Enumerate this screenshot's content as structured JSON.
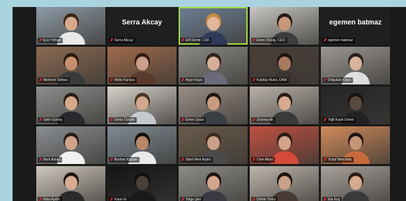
{
  "meeting": {
    "participants": [
      {
        "name": "Ece Yılmaz",
        "camera": true,
        "skin": "#d8a988",
        "hair": "#3a2616",
        "shirt": "#e9e9ea",
        "bg": "#8c9aa6"
      },
      {
        "name": "Serra Akcay",
        "camera": false,
        "display_name": "Serra Akcay"
      },
      {
        "name": "Elif Demir, CSK",
        "camera": true,
        "active": true,
        "skin": "#e3b59a",
        "hair": "#c78a3e",
        "shirt": "#2f3a58",
        "bg": "#6d7f96"
      },
      {
        "name": "Emre Okyay, CEO",
        "camera": true,
        "skin": "#c9977a",
        "hair": "#241a14",
        "shirt": "#3c3c3c",
        "bg": "#c8c6c2"
      },
      {
        "name": "egemen batmaz",
        "camera": false,
        "display_name": "egemen batmaz"
      },
      {
        "name": "Mehmet Tahtacı",
        "camera": true,
        "skin": "#c68e6c",
        "hair": "#2a1c12",
        "shirt": "#3b3a3a",
        "bg": "#8b6a52"
      },
      {
        "name": "Melis Karaca",
        "camera": true,
        "skin": "#caa08a",
        "hair": "#2d1b12",
        "shirt": "#5a3a2c",
        "bg": "#a06a4a"
      },
      {
        "name": "Ayşe Kaya",
        "camera": true,
        "skin": "#d8ae98",
        "hair": "#2e2019",
        "shirt": "#6a6a78",
        "bg": "#8b8a85"
      },
      {
        "name": "Kubilay Bulut, DAM",
        "camera": true,
        "skin": "#a87a60",
        "hair": "#1f1712",
        "shirt": "#3a3330",
        "bg": "#4a3f36"
      },
      {
        "name": "Doğukan Kaya",
        "camera": true,
        "skin": "#d9b29c",
        "hair": "#2a1e18",
        "shirt": "#dedede",
        "bg": "#9a9794"
      },
      {
        "name": "Selin Güneş",
        "camera": true,
        "skin": "#d6a888",
        "hair": "#2b1e15",
        "shirt": "#2a2a2e",
        "bg": "#8c8f8c"
      },
      {
        "name": "Deniz Öztürk",
        "camera": true,
        "skin": "#d2a88d",
        "hair": "#4a3422",
        "shirt": "#c5c9cf",
        "bg": "#d6d2cb"
      },
      {
        "name": "Emre Uysal",
        "camera": true,
        "skin": "#c99a7c",
        "hair": "#1e1712",
        "shirt": "#3a3f44",
        "bg": "#9a8f86"
      },
      {
        "name": "Zeynep Ak",
        "camera": true,
        "skin": "#d8aa92",
        "hair": "#2b1c15",
        "shirt": "#3a3a3a",
        "bg": "#b8b2aa"
      },
      {
        "name": "Yiğit Kaan Demir",
        "camera": true,
        "skin": "#5a4a40",
        "hair": "#1a1410",
        "shirt": "#222222",
        "bg": "#252525"
      },
      {
        "name": "Berk Aslan",
        "camera": true,
        "skin": "#d0a28a",
        "hair": "#2a1e16",
        "shirt": "#f0f0f0",
        "bg": "#8a8e92"
      },
      {
        "name": "Burhan Kaplan",
        "camera": true,
        "skin": "#b88868",
        "hair": "#14100d",
        "shirt": "#eaeaea",
        "bg": "#7e8b94"
      },
      {
        "name": "Sibel Mert Aydın",
        "camera": true,
        "skin": "#caa088",
        "hair": "#3c2a1c",
        "shirt": "#4a4a4a",
        "bg": "#6a5a4a"
      },
      {
        "name": "Cem Altun",
        "camera": true,
        "skin": "#d2a58a",
        "hair": "#2a1c14",
        "shirt": "#d64a3a",
        "bg": "#c05040"
      },
      {
        "name": "Yusuf Mert Ada",
        "camera": true,
        "skin": "#c79474",
        "hair": "#1c1510",
        "shirt": "#c96a3a",
        "bg": "#d08a5a"
      },
      {
        "name": "Nisa Aydın",
        "camera": true,
        "skin": "#d8ac92",
        "hair": "#1e1510",
        "shirt": "#2b2b2b",
        "bg": "#cfc8be"
      },
      {
        "name": "Kaan Er",
        "camera": true,
        "skin": "#4a403a",
        "hair": "#111111",
        "shirt": "#1a1a1a",
        "bg": "#141414"
      },
      {
        "name": "Tolga Şen",
        "camera": true,
        "skin": "#d4a68c",
        "hair": "#1c1410",
        "shirt": "#3a3a44",
        "bg": "#8c8c88"
      },
      {
        "name": "Defne Yıldız",
        "camera": true,
        "skin": "#caa088",
        "hair": "#1a120d",
        "shirt": "#4a3a34",
        "bg": "#bdb6ac"
      },
      {
        "name": "Ela Koç",
        "camera": true,
        "skin": "#d6aa8e",
        "hair": "#2a1c14",
        "shirt": "#3a3a3a",
        "bg": "#a7a29b"
      }
    ]
  }
}
